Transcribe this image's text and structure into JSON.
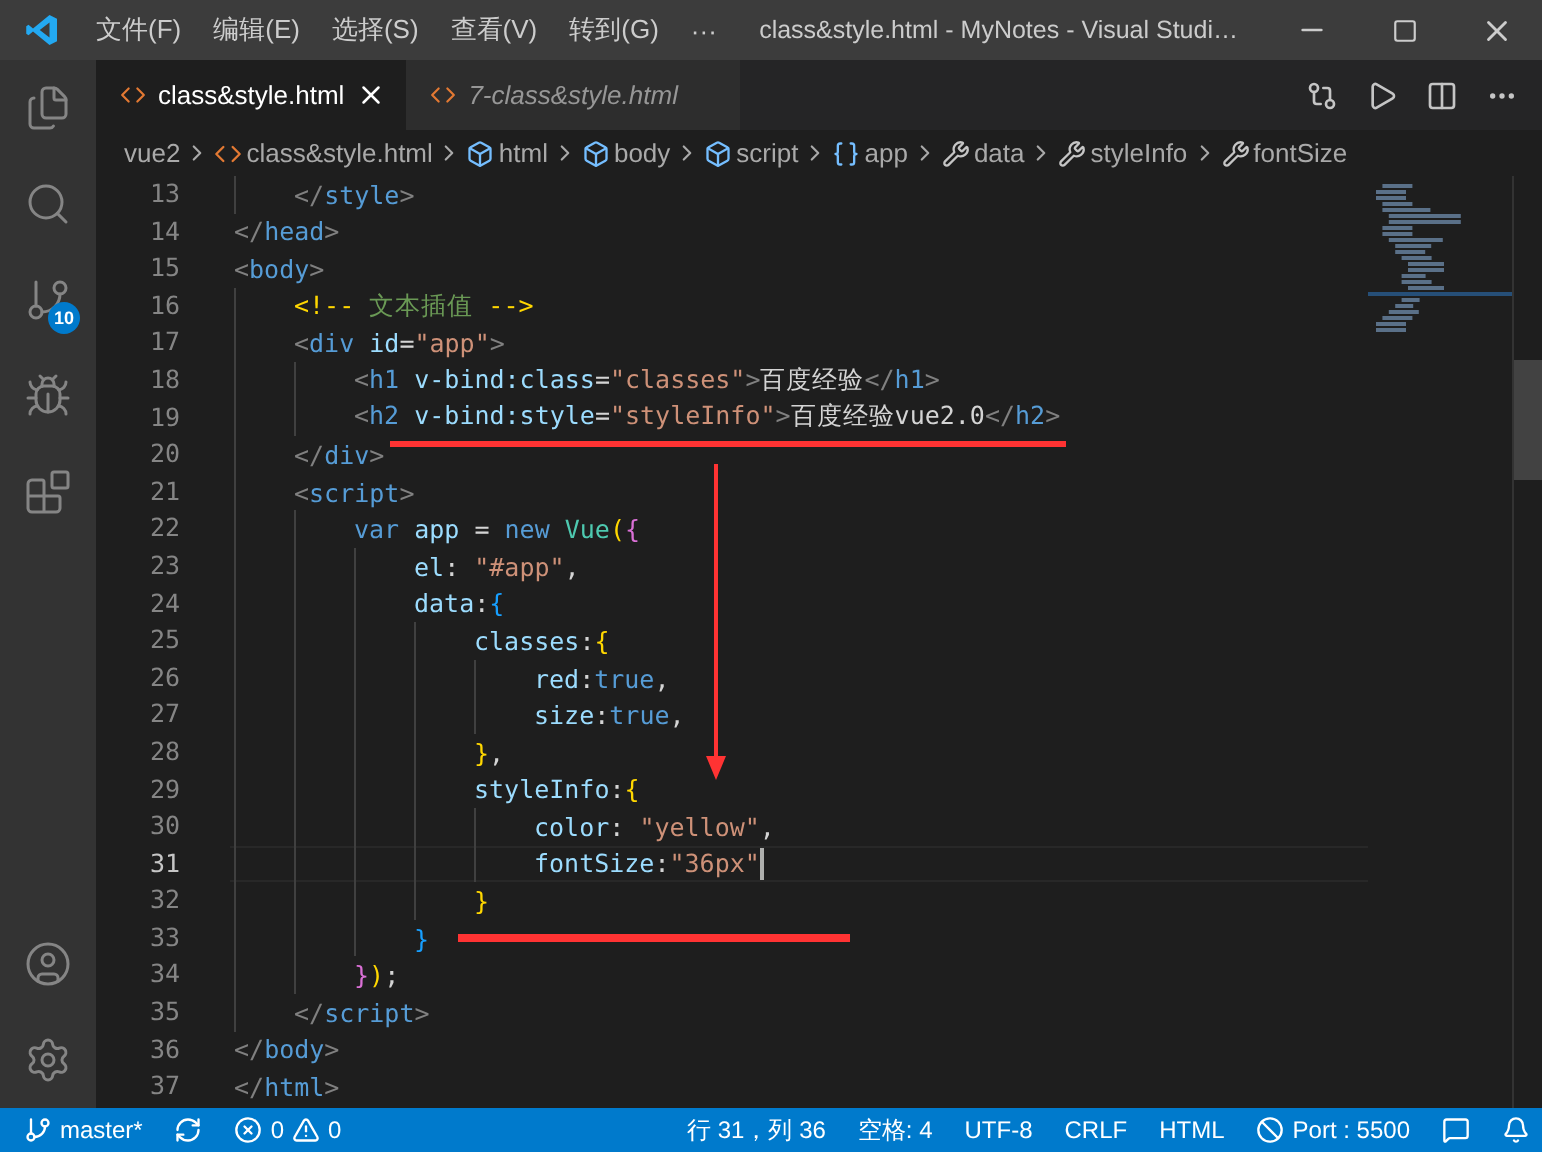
{
  "title_bar": {
    "menus": [
      "文件(F)",
      "编辑(E)",
      "选择(S)",
      "查看(V)",
      "转到(G)"
    ],
    "more": "···",
    "title": "class&style.html - MyNotes - Visual Studi…"
  },
  "activity_bar": {
    "top": [
      {
        "kind": "explorer"
      },
      {
        "kind": "search"
      },
      {
        "kind": "source-control",
        "badge": "10"
      },
      {
        "kind": "run-debug"
      },
      {
        "kind": "extensions"
      }
    ],
    "bottom": [
      {
        "kind": "account"
      },
      {
        "kind": "settings"
      }
    ]
  },
  "tabs": [
    {
      "label": "class&style.html",
      "selected": true,
      "preview": false
    },
    {
      "label": "7-class&style.html",
      "selected": false,
      "preview": true
    }
  ],
  "breadcrumb": [
    {
      "kind": "folder",
      "label": "vue2"
    },
    {
      "kind": "file",
      "label": "class&style.html"
    },
    {
      "kind": "element",
      "label": "html"
    },
    {
      "kind": "element",
      "label": "body"
    },
    {
      "kind": "element",
      "label": "script"
    },
    {
      "kind": "variable",
      "label": "app"
    },
    {
      "kind": "property",
      "label": "data"
    },
    {
      "kind": "property",
      "label": "styleInfo"
    },
    {
      "kind": "property",
      "label": "fontSize"
    }
  ],
  "code": [
    {
      "number": "13",
      "current": false,
      "tokens": [
        {
          "kind": "punct",
          "text": "    </"
        },
        {
          "kind": "tag",
          "text": "style"
        },
        {
          "kind": "punct",
          "text": ">"
        }
      ]
    },
    {
      "number": "14",
      "current": false,
      "tokens": [
        {
          "kind": "punct",
          "text": "</"
        },
        {
          "kind": "tag",
          "text": "head"
        },
        {
          "kind": "punct",
          "text": ">"
        }
      ]
    },
    {
      "number": "15",
      "current": false,
      "tokens": [
        {
          "kind": "punct",
          "text": "<"
        },
        {
          "kind": "tag",
          "text": "body"
        },
        {
          "kind": "punct",
          "text": ">"
        }
      ]
    },
    {
      "number": "16",
      "current": false,
      "tokens": [
        {
          "kind": "bracket1",
          "text": "    <!--"
        },
        {
          "kind": "comment",
          "text": " 文本插值 "
        },
        {
          "kind": "bracket1",
          "text": "-->"
        }
      ]
    },
    {
      "number": "17",
      "current": false,
      "tokens": [
        {
          "kind": "punct",
          "text": "    <"
        },
        {
          "kind": "tag",
          "text": "div"
        },
        {
          "kind": "attr",
          "text": " id"
        },
        {
          "kind": "plain",
          "text": "="
        },
        {
          "kind": "string",
          "text": "\"app\""
        },
        {
          "kind": "punct",
          "text": ">"
        }
      ]
    },
    {
      "number": "18",
      "current": false,
      "tokens": [
        {
          "kind": "punct",
          "text": "        <"
        },
        {
          "kind": "tag",
          "text": "h1"
        },
        {
          "kind": "attr",
          "text": " v-bind:class"
        },
        {
          "kind": "plain",
          "text": "="
        },
        {
          "kind": "string",
          "text": "\"classes\""
        },
        {
          "kind": "punct",
          "text": ">"
        },
        {
          "kind": "plain",
          "text": "百度经验"
        },
        {
          "kind": "punct",
          "text": "</"
        },
        {
          "kind": "tag",
          "text": "h1"
        },
        {
          "kind": "punct",
          "text": ">"
        }
      ]
    },
    {
      "number": "19",
      "current": false,
      "tokens": [
        {
          "kind": "punct",
          "text": "        <"
        },
        {
          "kind": "tag",
          "text": "h2"
        },
        {
          "kind": "attr",
          "text": " v-bind:style"
        },
        {
          "kind": "plain",
          "text": "="
        },
        {
          "kind": "string",
          "text": "\"styleInfo\""
        },
        {
          "kind": "punct",
          "text": ">"
        },
        {
          "kind": "plain",
          "text": "百度经验vue2.0"
        },
        {
          "kind": "punct",
          "text": "</"
        },
        {
          "kind": "tag",
          "text": "h2"
        },
        {
          "kind": "punct",
          "text": ">"
        }
      ]
    },
    {
      "number": "20",
      "current": false,
      "tokens": [
        {
          "kind": "punct",
          "text": "    </"
        },
        {
          "kind": "tag",
          "text": "div"
        },
        {
          "kind": "punct",
          "text": ">"
        }
      ]
    },
    {
      "number": "21",
      "current": false,
      "tokens": [
        {
          "kind": "punct",
          "text": "    <"
        },
        {
          "kind": "tag",
          "text": "script"
        },
        {
          "kind": "punct",
          "text": ">"
        }
      ]
    },
    {
      "number": "22",
      "current": false,
      "tokens": [
        {
          "kind": "keyword",
          "text": "        var"
        },
        {
          "kind": "variable",
          "text": " app"
        },
        {
          "kind": "plain",
          "text": " = "
        },
        {
          "kind": "keyword",
          "text": "new"
        },
        {
          "kind": "class",
          "text": " Vue"
        },
        {
          "kind": "bracket1",
          "text": "("
        },
        {
          "kind": "bracket2",
          "text": "{"
        }
      ]
    },
    {
      "number": "23",
      "current": false,
      "tokens": [
        {
          "kind": "variable",
          "text": "            el"
        },
        {
          "kind": "plain",
          "text": ": "
        },
        {
          "kind": "string",
          "text": "\"#app\""
        },
        {
          "kind": "plain",
          "text": ","
        }
      ]
    },
    {
      "number": "24",
      "current": false,
      "tokens": [
        {
          "kind": "variable",
          "text": "            data"
        },
        {
          "kind": "plain",
          "text": ":"
        },
        {
          "kind": "bracket3",
          "text": "{"
        }
      ]
    },
    {
      "number": "25",
      "current": false,
      "tokens": [
        {
          "kind": "variable",
          "text": "                classes"
        },
        {
          "kind": "plain",
          "text": ":"
        },
        {
          "kind": "bracket1",
          "text": "{"
        }
      ]
    },
    {
      "number": "26",
      "current": false,
      "tokens": [
        {
          "kind": "variable",
          "text": "                    red"
        },
        {
          "kind": "plain",
          "text": ":"
        },
        {
          "kind": "keyword",
          "text": "true"
        },
        {
          "kind": "plain",
          "text": ","
        }
      ]
    },
    {
      "number": "27",
      "current": false,
      "tokens": [
        {
          "kind": "variable",
          "text": "                    size"
        },
        {
          "kind": "plain",
          "text": ":"
        },
        {
          "kind": "keyword",
          "text": "true"
        },
        {
          "kind": "plain",
          "text": ","
        }
      ]
    },
    {
      "number": "28",
      "current": false,
      "tokens": [
        {
          "kind": "bracket1",
          "text": "                }"
        },
        {
          "kind": "plain",
          "text": ","
        }
      ]
    },
    {
      "number": "29",
      "current": false,
      "tokens": [
        {
          "kind": "variable",
          "text": "                styleInfo"
        },
        {
          "kind": "plain",
          "text": ":"
        },
        {
          "kind": "bracket1",
          "text": "{"
        }
      ]
    },
    {
      "number": "30",
      "current": false,
      "tokens": [
        {
          "kind": "variable",
          "text": "                    color"
        },
        {
          "kind": "plain",
          "text": ": "
        },
        {
          "kind": "string",
          "text": "\"yellow\""
        },
        {
          "kind": "plain",
          "text": ","
        }
      ]
    },
    {
      "number": "31",
      "current": true,
      "tokens": [
        {
          "kind": "variable",
          "text": "                    fontSize"
        },
        {
          "kind": "plain",
          "text": ":"
        },
        {
          "kind": "string",
          "text": "\"36px\""
        }
      ]
    },
    {
      "number": "32",
      "current": false,
      "tokens": [
        {
          "kind": "bracket1",
          "text": "                }"
        }
      ]
    },
    {
      "number": "33",
      "current": false,
      "tokens": [
        {
          "kind": "bracket3",
          "text": "            }"
        }
      ]
    },
    {
      "number": "34",
      "current": false,
      "tokens": [
        {
          "kind": "bracket2",
          "text": "        }"
        },
        {
          "kind": "bracket1",
          "text": ")"
        },
        {
          "kind": "plain",
          "text": ";"
        }
      ]
    },
    {
      "number": "35",
      "current": false,
      "tokens": [
        {
          "kind": "punct",
          "text": "    </"
        },
        {
          "kind": "tag",
          "text": "script"
        },
        {
          "kind": "punct",
          "text": ">"
        }
      ]
    },
    {
      "number": "36",
      "current": false,
      "tokens": [
        {
          "kind": "punct",
          "text": "</"
        },
        {
          "kind": "tag",
          "text": "body"
        },
        {
          "kind": "punct",
          "text": ">"
        }
      ]
    },
    {
      "number": "37",
      "current": false,
      "tokens": [
        {
          "kind": "punct",
          "text": "</"
        },
        {
          "kind": "tag",
          "text": "html"
        },
        {
          "kind": "punct",
          "text": ">"
        }
      ]
    }
  ],
  "status_bar": {
    "left": [
      {
        "kind": "branch",
        "text": "master*"
      },
      {
        "kind": "sync"
      },
      {
        "kind": "errors",
        "text": "0"
      },
      {
        "kind": "warnings",
        "text": "0"
      }
    ],
    "right": [
      {
        "kind": "text",
        "text": "行 31，列 36"
      },
      {
        "kind": "text",
        "text": "空格: 4"
      },
      {
        "kind": "text",
        "text": "UTF-8"
      },
      {
        "kind": "text",
        "text": "CRLF"
      },
      {
        "kind": "text",
        "text": "HTML"
      },
      {
        "kind": "port",
        "text": "Port : 5500"
      },
      {
        "kind": "feedback"
      },
      {
        "kind": "bell"
      }
    ]
  }
}
